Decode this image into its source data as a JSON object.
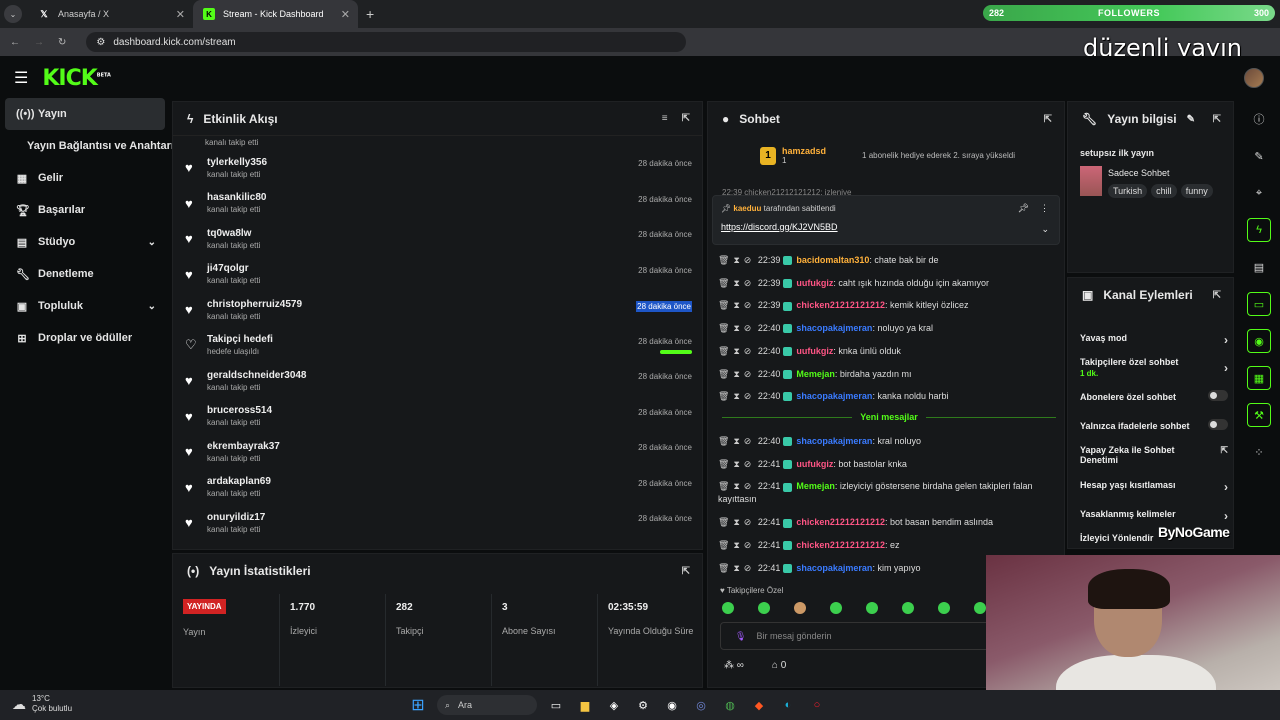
{
  "browser": {
    "tabs": [
      {
        "label": "Anasayfa / X",
        "icon": "x-logo-icon",
        "active": false
      },
      {
        "label": "Stream - Kick Dashboard",
        "icon": "kick-logo-icon",
        "active": true
      }
    ],
    "url": "dashboard.kick.com/stream"
  },
  "overlay": {
    "followers_start": "282",
    "followers_label": "FOLLOWERS",
    "followers_goal": "300",
    "followers_progress": 0.94,
    "title": "düzenli yayın #1",
    "sponsor": "ByNoGame"
  },
  "header": {
    "logo": "KICK",
    "logo_sup": "BETA"
  },
  "sidebar": {
    "items": [
      {
        "label": "Yayın",
        "icon": "broadcast-icon",
        "active": true
      },
      {
        "label": "Yayın Bağlantısı ve Anahtarı",
        "icon": "",
        "active": false
      },
      {
        "label": "Gelir",
        "icon": "dollar-icon"
      },
      {
        "label": "Başarılar",
        "icon": "trophy-icon"
      },
      {
        "label": "Stüdyo",
        "icon": "studio-icon",
        "chevron": true
      },
      {
        "label": "Denetleme",
        "icon": "wrench-icon"
      },
      {
        "label": "Topluluk",
        "icon": "community-icon",
        "chevron": true
      },
      {
        "label": "Droplar ve ödüller",
        "icon": "gift-icon"
      }
    ]
  },
  "activity": {
    "title": "Etkinlik Akışı",
    "events": [
      {
        "name": "tylerkelly356",
        "sub": "kanalı takip etti",
        "time": "28 dakika önce"
      },
      {
        "name": "hasankilic80",
        "sub": "kanalı takip etti",
        "time": "28 dakika önce"
      },
      {
        "name": "tq0wa8lw",
        "sub": "kanalı takip etti",
        "time": "28 dakika önce"
      },
      {
        "name": "ji47qolgr",
        "sub": "kanalı takip etti",
        "time": "28 dakika önce"
      },
      {
        "name": "christopherruiz4579",
        "sub": "kanalı takip etti",
        "time": "28 dakika önce"
      },
      {
        "name": "Takipçi hedefi",
        "sub": "hedefe ulaşıldı",
        "time": "28 dakika önce"
      },
      {
        "name": "geraldschneider3048",
        "sub": "kanalı takip etti",
        "time": "28 dakika önce"
      },
      {
        "name": "bruceross514",
        "sub": "kanalı takip etti",
        "time": "28 dakika önce"
      },
      {
        "name": "ekrembayrak37",
        "sub": "kanalı takip etti",
        "time": "28 dakika önce"
      },
      {
        "name": "ardakaplan69",
        "sub": "kanalı takip etti",
        "time": "28 dakika önce"
      },
      {
        "name": "onuryildiz17",
        "sub": "kanalı takip etti",
        "time": "28 dakika önce"
      }
    ],
    "top_partial_sub": "kanalı takip etti",
    "goal_progress": 1.0
  },
  "stats": {
    "title": "Yayın İstatistikleri",
    "live_badge": "YAYINDA",
    "items": [
      {
        "value": "",
        "label": "Yayın"
      },
      {
        "value": "1.770",
        "label": "İzleyici"
      },
      {
        "value": "282",
        "label": "Takipçi"
      },
      {
        "value": "3",
        "label": "Abone Sayısı"
      },
      {
        "value": "02:35:59",
        "label": "Yayında Olduğu Süre"
      }
    ]
  },
  "chat": {
    "title": "Sohbet",
    "top_user": "hamzadsd",
    "top_user_count": "1",
    "top_notice": "1 abonelik hediye ederek 2. sıraya yükseldi",
    "pinned_by": "kaeduu",
    "pinned_suffix": "tarafından sabitlendi",
    "pinned_link": "https://discord.gg/KJ2VN5BD",
    "partial_top": "22:39 chicken21212121212: izleniye",
    "messages": [
      {
        "time": "22:39",
        "user": "bacidomaltan310",
        "color": "orange",
        "text": ": chate bak bir de"
      },
      {
        "time": "22:39",
        "user": "uufukgiz",
        "color": "pink",
        "text": ": caht ışık hızında olduğu için akamıyor"
      },
      {
        "time": "22:39",
        "user": "chicken21212121212",
        "color": "pink",
        "text": ": kemik kitleyi özlicez"
      },
      {
        "time": "22:40",
        "user": "shacopakajmeran",
        "color": "blue",
        "text": ": noluyo ya kral"
      },
      {
        "time": "22:40",
        "user": "uufukgiz",
        "color": "pink",
        "text": ": knka ünlü olduk"
      },
      {
        "time": "22:40",
        "user": "Memejan",
        "color": "green",
        "text": ": birdaha yazdın mı"
      },
      {
        "time": "22:40",
        "user": "shacopakajmeran",
        "color": "blue",
        "text": ": kanka noldu harbi"
      }
    ],
    "new_label": "Yeni mesajlar",
    "new_messages": [
      {
        "time": "22:40",
        "user": "shacopakajmeran",
        "color": "blue",
        "text": ": kral noluyo"
      },
      {
        "time": "22:41",
        "user": "uufukgiz",
        "color": "pink",
        "text": ": bot bastolar knka"
      },
      {
        "time": "22:41",
        "user": "Memejan",
        "color": "green",
        "text": ": izleyiciyi göstersene birdaha gelen takipleri falan kayıttasın"
      },
      {
        "time": "22:41",
        "user": "chicken21212121212",
        "color": "pink",
        "text": ": bot basan bendim aslında"
      },
      {
        "time": "22:41",
        "user": "chicken21212121212",
        "color": "pink",
        "text": ": ez"
      },
      {
        "time": "22:41",
        "user": "shacopakajmeran",
        "color": "blue",
        "text": ": kim yapıyo"
      }
    ],
    "followers_only": "Takipçilere Özel",
    "input_placeholder": "Bir mesaj gönderin",
    "infinity": "∞",
    "store_count": "0"
  },
  "info": {
    "title": "Yayın bilgisi",
    "stream_title": "setupsız ilk yayın",
    "category": "Sadece Sohbet",
    "tags": [
      "Turkish",
      "chill",
      "funny"
    ]
  },
  "actions": {
    "title": "Kanal Eylemleri",
    "rows": [
      {
        "label": "Yavaş mod",
        "type": "arrow"
      },
      {
        "label": "Takipçilere özel sohbet",
        "sub": "1 dk.",
        "type": "arrow"
      },
      {
        "label": "Abonelere özel sohbet",
        "type": "toggle"
      },
      {
        "label": "Yalnızca ifadelerle sohbet",
        "type": "toggle"
      },
      {
        "label": "Yapay Zeka ile Sohbet Denetimi",
        "type": "external"
      },
      {
        "label": "Hesap yaşı kısıtlaması",
        "type": "arrow"
      },
      {
        "label": "Yasaklanmış kelimeler",
        "type": "arrow"
      },
      {
        "label": "İzleyici Yönlendir",
        "type": "arrow"
      }
    ]
  },
  "taskbar": {
    "temp": "13°C",
    "weather": "Çok bulutlu",
    "search": "Ara"
  }
}
